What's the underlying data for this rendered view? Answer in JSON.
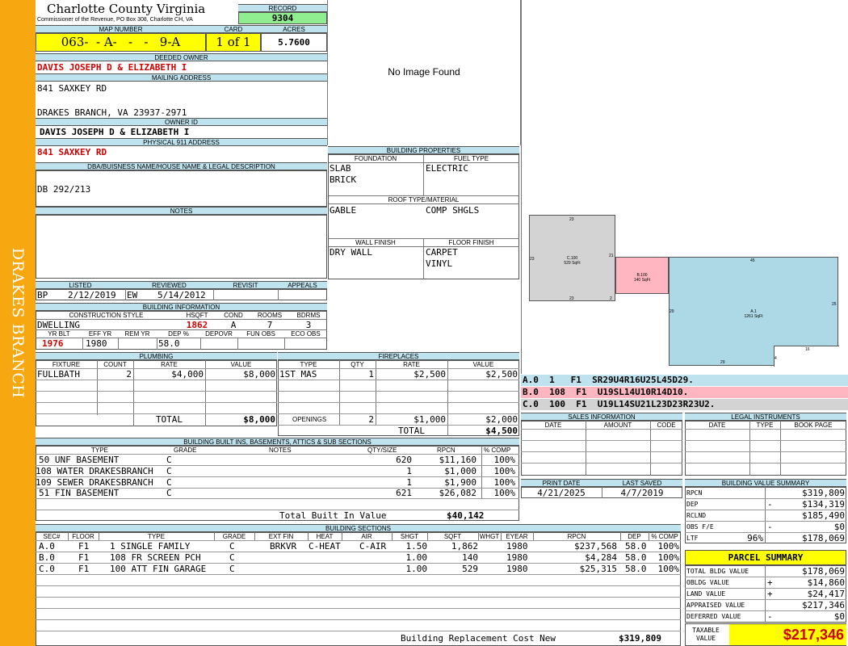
{
  "county": {
    "name": "Charlotte County Virginia",
    "commissioner": "Commissioner of the Revenue, PO Box 308, Charlotte CH, VA"
  },
  "side_label": "DRAKES BRANCH",
  "record": {
    "label": "RECORD",
    "value": "9304"
  },
  "map": {
    "label": "MAP NUMBER",
    "value": "063-  - A-   -   -   9-A"
  },
  "card": {
    "label": "CARD",
    "value": "1 of 1"
  },
  "acres": {
    "label": "ACRES",
    "value": "5.7600"
  },
  "deeded_owner": {
    "label": "DEEDED OWNER",
    "value": "DAVIS JOSEPH D & ELIZABETH I"
  },
  "mailing": {
    "label": "MAILING ADDRESS",
    "line1": "841 SAXKEY RD",
    "line2": "DRAKES BRANCH, VA 23937-2971"
  },
  "owner_id": {
    "label": "OWNER ID",
    "value": "DAVIS JOSEPH D & ELIZABETH I"
  },
  "physical": {
    "label": "PHYSICAL 911 ADDRESS",
    "value": "841 SAXKEY RD"
  },
  "legal": {
    "label": "DBA/BUISNESS NAME/HOUSE NAME & LEGAL DESCRIPTION",
    "value": "DB 292/213"
  },
  "notes": {
    "label": "NOTES"
  },
  "listed": {
    "label": "LISTED",
    "who": "BP",
    "date": "2/12/2019"
  },
  "reviewed": {
    "label": "REVIEWED",
    "who": "EW",
    "date": "5/14/2012"
  },
  "revisit": {
    "label": "REVISIT"
  },
  "appeals": {
    "label": "APPEALS"
  },
  "bldg_info": {
    "title": "BUILDING INFORMATION",
    "h_style": "CONSTRUCTION STYLE",
    "h_hsqft": "HSQFT",
    "h_cond": "COND",
    "h_rooms": "ROOMS",
    "h_bdrms": "BDRMS",
    "style": "DWELLING",
    "hsqft": "1862",
    "cond": "A",
    "rooms": "7",
    "bdrms": "3",
    "h_yrblt": "YR BLT",
    "h_effyr": "EFF YR",
    "h_remyr": "REM YR",
    "h_dep": "DEP %",
    "h_depovr": "DEPOVR",
    "h_funobs": "FUN OBS",
    "h_ecoobs": "ECO OBS",
    "yrblt": "1976",
    "effyr": "1980",
    "dep": "58.0"
  },
  "image": {
    "text": "No Image Found"
  },
  "bprops": {
    "title": "BUILDING PROPERTIES",
    "h_foundation": "FOUNDATION",
    "h_fuel": "FUEL TYPE",
    "foundation1": "SLAB",
    "foundation2": "BRICK",
    "fuel": "ELECTRIC",
    "h_roof": "ROOF TYPE/MATERIAL",
    "roof1": "GABLE",
    "roof2": "COMP SHGLS",
    "h_wall": "WALL FINISH",
    "h_floor": "FLOOR FINISH",
    "wall": "DRY WALL",
    "floor1": "CARPET",
    "floor2": "VINYL"
  },
  "sketch": {
    "a": {
      "name": "C.100",
      "area": "529 SqFt",
      "top": "23",
      "left": "23",
      "right": "21",
      "bottom": "23",
      "br": "2"
    },
    "b": {
      "name": "B.100",
      "area": "140 SqFt"
    },
    "c": {
      "name": "A.1",
      "area": "1261 SqFt",
      "top": "45",
      "right": "25",
      "left": "29",
      "bottom": "29",
      "b2": "4",
      "b3": "16"
    }
  },
  "sketch_legend": [
    {
      "text": "A.0  1   F1  SR29U4R16U25L45D29.",
      "color": "#bfe3ee"
    },
    {
      "text": "B.0  108  F1  U19SL14U10R14D10.",
      "color": "#ffb6c1"
    },
    {
      "text": "C.0  100  F1  U19L14SU21L23D23R23U2.",
      "color": "#d3d3d3"
    }
  ],
  "plumbing": {
    "title": "PLUMBING",
    "h_fixture": "FIXTURE",
    "h_count": "COUNT",
    "h_rate": "RATE",
    "h_value": "VALUE",
    "rows": [
      {
        "fixture": "FULLBATH",
        "count": "2",
        "rate": "$4,000",
        "value": "$8,000"
      }
    ],
    "total_label": "TOTAL",
    "total": "$8,000"
  },
  "fireplaces": {
    "title": "FIREPLACES",
    "h_type": "TYPE",
    "h_qty": "QTY",
    "h_rate": "RATE",
    "h_value": "VALUE",
    "rows": [
      {
        "type": "1ST MAS",
        "qty": "1",
        "rate": "$2,500",
        "value": "$2,500"
      }
    ],
    "openings_label": "OPENINGS",
    "openings_qty": "2",
    "openings_rate": "$1,000",
    "openings_value": "$2,000",
    "total_label": "TOTAL",
    "total": "$4,500"
  },
  "sales": {
    "title": "SALES INFORMATION",
    "h_date": "DATE",
    "h_amount": "AMOUNT",
    "h_code": "CODE"
  },
  "legal_inst": {
    "title": "LEGAL INSTRUMENTS",
    "h_date": "DATE",
    "h_type": "TYPE",
    "h_book": "BOOK PAGE"
  },
  "builtins": {
    "title": "BUILDING BUILT INS, BASEMENTS, ATTICS & SUB SECTIONS",
    "h_type": "TYPE",
    "h_grade": "GRADE",
    "h_notes": "NOTES",
    "h_qty": "QTY/SIZE",
    "h_rpcn": "RPCN",
    "h_comp": "% COMP",
    "rows": [
      {
        "type": "50 UNF BASEMENT",
        "grade": "C",
        "qty": "620",
        "rpcn": "$11,160",
        "comp": "100%"
      },
      {
        "type": "108 WATER DRAKESBRANCH",
        "grade": "C",
        "qty": "1",
        "rpcn": "$1,000",
        "comp": "100%"
      },
      {
        "type": "109 SEWER DRAKESBRANCH",
        "grade": "C",
        "qty": "1",
        "rpcn": "$1,900",
        "comp": "100%"
      },
      {
        "type": "51 FIN BASEMENT",
        "grade": "C",
        "qty": "621",
        "rpcn": "$26,082",
        "comp": "100%"
      }
    ],
    "total_label": "Total Built In Value",
    "total": "$40,142"
  },
  "print": {
    "h_print": "PRINT DATE",
    "h_saved": "LAST SAVED",
    "print": "4/21/2025",
    "saved": "4/7/2019"
  },
  "bvs": {
    "title": "BUILDING VALUE SUMMARY",
    "rows": [
      {
        "label": "RPCN",
        "sign": "",
        "pct": "",
        "value": "$319,809"
      },
      {
        "label": "DEP",
        "sign": "-",
        "pct": "",
        "value": "$134,319"
      },
      {
        "label": "RCLND",
        "sign": "",
        "pct": "",
        "value": "$185,490"
      },
      {
        "label": "OBS F/E",
        "sign": "-",
        "pct": "",
        "value": "$0"
      },
      {
        "label": "LTF",
        "sign": "",
        "pct": "96%",
        "value": "$178,069"
      }
    ]
  },
  "sections": {
    "title": "BUILDING SECTIONS",
    "h": [
      "SEC#",
      "FLOOR",
      "TYPE",
      "GRADE",
      "EXT FIN",
      "HEAT",
      "AIR",
      "SHGT",
      "SQFT",
      "WHGT",
      "EYEAR",
      "RPCN",
      "DEP",
      "% COMP"
    ],
    "rows": [
      {
        "sec": "A.0",
        "floor": "F1",
        "type": "1 SINGLE FAMILY",
        "grade": "C",
        "ext": "BRKVR",
        "heat": "C-HEAT",
        "air": "C-AIR",
        "shgt": "1.50",
        "sqft": "1,862",
        "whgt": "",
        "eyear": "1980",
        "rpcn": "$237,568",
        "dep": "58.0",
        "comp": "100%"
      },
      {
        "sec": "B.0",
        "floor": "F1",
        "type": "108 FR SCREEN PCH",
        "grade": "C",
        "ext": "",
        "heat": "",
        "air": "",
        "shgt": "1.00",
        "sqft": "140",
        "whgt": "",
        "eyear": "1980",
        "rpcn": "$4,284",
        "dep": "58.0",
        "comp": "100%"
      },
      {
        "sec": "C.0",
        "floor": "F1",
        "type": "100 ATT FIN GARAGE",
        "grade": "C",
        "ext": "",
        "heat": "",
        "air": "",
        "shgt": "1.00",
        "sqft": "529",
        "whgt": "",
        "eyear": "1980",
        "rpcn": "$25,315",
        "dep": "58.0",
        "comp": "100%"
      }
    ],
    "total_label": "Building Replacement Cost New",
    "total": "$319,809"
  },
  "parcel": {
    "title": "PARCEL SUMMARY",
    "rows": [
      {
        "label": "TOTAL BLDG VALUE",
        "sign": "",
        "value": "$178,069"
      },
      {
        "label": "OBLDG VALUE",
        "sign": "+",
        "value": "$14,860"
      },
      {
        "label": "LAND VALUE",
        "sign": "+",
        "value": "$24,417"
      },
      {
        "label": "APPRAISED VALUE",
        "sign": "",
        "value": "$217,346"
      },
      {
        "label": "DEFERRED VALUE",
        "sign": "-",
        "value": "$0"
      }
    ],
    "taxable_label": "TAXABLE VALUE",
    "taxable": "$217,346"
  },
  "colors": {
    "side": "#f7a70f",
    "header": "#bfe3ee",
    "yellow": "#ffff00",
    "green": "#90ee90",
    "red": "#d00000",
    "pink": "#ffb6c1",
    "gray": "#d3d3d3",
    "blue": "#add8e6"
  }
}
